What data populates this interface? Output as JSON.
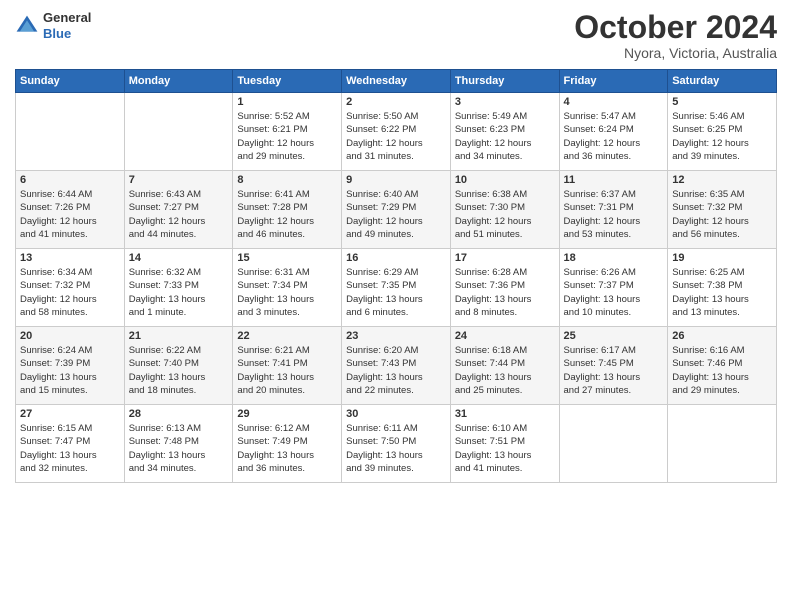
{
  "header": {
    "logo_line1": "General",
    "logo_line2": "Blue",
    "month": "October 2024",
    "location": "Nyora, Victoria, Australia"
  },
  "weekdays": [
    "Sunday",
    "Monday",
    "Tuesday",
    "Wednesday",
    "Thursday",
    "Friday",
    "Saturday"
  ],
  "weeks": [
    [
      {
        "day": "",
        "info": ""
      },
      {
        "day": "",
        "info": ""
      },
      {
        "day": "1",
        "info": "Sunrise: 5:52 AM\nSunset: 6:21 PM\nDaylight: 12 hours\nand 29 minutes."
      },
      {
        "day": "2",
        "info": "Sunrise: 5:50 AM\nSunset: 6:22 PM\nDaylight: 12 hours\nand 31 minutes."
      },
      {
        "day": "3",
        "info": "Sunrise: 5:49 AM\nSunset: 6:23 PM\nDaylight: 12 hours\nand 34 minutes."
      },
      {
        "day": "4",
        "info": "Sunrise: 5:47 AM\nSunset: 6:24 PM\nDaylight: 12 hours\nand 36 minutes."
      },
      {
        "day": "5",
        "info": "Sunrise: 5:46 AM\nSunset: 6:25 PM\nDaylight: 12 hours\nand 39 minutes."
      }
    ],
    [
      {
        "day": "6",
        "info": "Sunrise: 6:44 AM\nSunset: 7:26 PM\nDaylight: 12 hours\nand 41 minutes."
      },
      {
        "day": "7",
        "info": "Sunrise: 6:43 AM\nSunset: 7:27 PM\nDaylight: 12 hours\nand 44 minutes."
      },
      {
        "day": "8",
        "info": "Sunrise: 6:41 AM\nSunset: 7:28 PM\nDaylight: 12 hours\nand 46 minutes."
      },
      {
        "day": "9",
        "info": "Sunrise: 6:40 AM\nSunset: 7:29 PM\nDaylight: 12 hours\nand 49 minutes."
      },
      {
        "day": "10",
        "info": "Sunrise: 6:38 AM\nSunset: 7:30 PM\nDaylight: 12 hours\nand 51 minutes."
      },
      {
        "day": "11",
        "info": "Sunrise: 6:37 AM\nSunset: 7:31 PM\nDaylight: 12 hours\nand 53 minutes."
      },
      {
        "day": "12",
        "info": "Sunrise: 6:35 AM\nSunset: 7:32 PM\nDaylight: 12 hours\nand 56 minutes."
      }
    ],
    [
      {
        "day": "13",
        "info": "Sunrise: 6:34 AM\nSunset: 7:32 PM\nDaylight: 12 hours\nand 58 minutes."
      },
      {
        "day": "14",
        "info": "Sunrise: 6:32 AM\nSunset: 7:33 PM\nDaylight: 13 hours\nand 1 minute."
      },
      {
        "day": "15",
        "info": "Sunrise: 6:31 AM\nSunset: 7:34 PM\nDaylight: 13 hours\nand 3 minutes."
      },
      {
        "day": "16",
        "info": "Sunrise: 6:29 AM\nSunset: 7:35 PM\nDaylight: 13 hours\nand 6 minutes."
      },
      {
        "day": "17",
        "info": "Sunrise: 6:28 AM\nSunset: 7:36 PM\nDaylight: 13 hours\nand 8 minutes."
      },
      {
        "day": "18",
        "info": "Sunrise: 6:26 AM\nSunset: 7:37 PM\nDaylight: 13 hours\nand 10 minutes."
      },
      {
        "day": "19",
        "info": "Sunrise: 6:25 AM\nSunset: 7:38 PM\nDaylight: 13 hours\nand 13 minutes."
      }
    ],
    [
      {
        "day": "20",
        "info": "Sunrise: 6:24 AM\nSunset: 7:39 PM\nDaylight: 13 hours\nand 15 minutes."
      },
      {
        "day": "21",
        "info": "Sunrise: 6:22 AM\nSunset: 7:40 PM\nDaylight: 13 hours\nand 18 minutes."
      },
      {
        "day": "22",
        "info": "Sunrise: 6:21 AM\nSunset: 7:41 PM\nDaylight: 13 hours\nand 20 minutes."
      },
      {
        "day": "23",
        "info": "Sunrise: 6:20 AM\nSunset: 7:43 PM\nDaylight: 13 hours\nand 22 minutes."
      },
      {
        "day": "24",
        "info": "Sunrise: 6:18 AM\nSunset: 7:44 PM\nDaylight: 13 hours\nand 25 minutes."
      },
      {
        "day": "25",
        "info": "Sunrise: 6:17 AM\nSunset: 7:45 PM\nDaylight: 13 hours\nand 27 minutes."
      },
      {
        "day": "26",
        "info": "Sunrise: 6:16 AM\nSunset: 7:46 PM\nDaylight: 13 hours\nand 29 minutes."
      }
    ],
    [
      {
        "day": "27",
        "info": "Sunrise: 6:15 AM\nSunset: 7:47 PM\nDaylight: 13 hours\nand 32 minutes."
      },
      {
        "day": "28",
        "info": "Sunrise: 6:13 AM\nSunset: 7:48 PM\nDaylight: 13 hours\nand 34 minutes."
      },
      {
        "day": "29",
        "info": "Sunrise: 6:12 AM\nSunset: 7:49 PM\nDaylight: 13 hours\nand 36 minutes."
      },
      {
        "day": "30",
        "info": "Sunrise: 6:11 AM\nSunset: 7:50 PM\nDaylight: 13 hours\nand 39 minutes."
      },
      {
        "day": "31",
        "info": "Sunrise: 6:10 AM\nSunset: 7:51 PM\nDaylight: 13 hours\nand 41 minutes."
      },
      {
        "day": "",
        "info": ""
      },
      {
        "day": "",
        "info": ""
      }
    ]
  ]
}
